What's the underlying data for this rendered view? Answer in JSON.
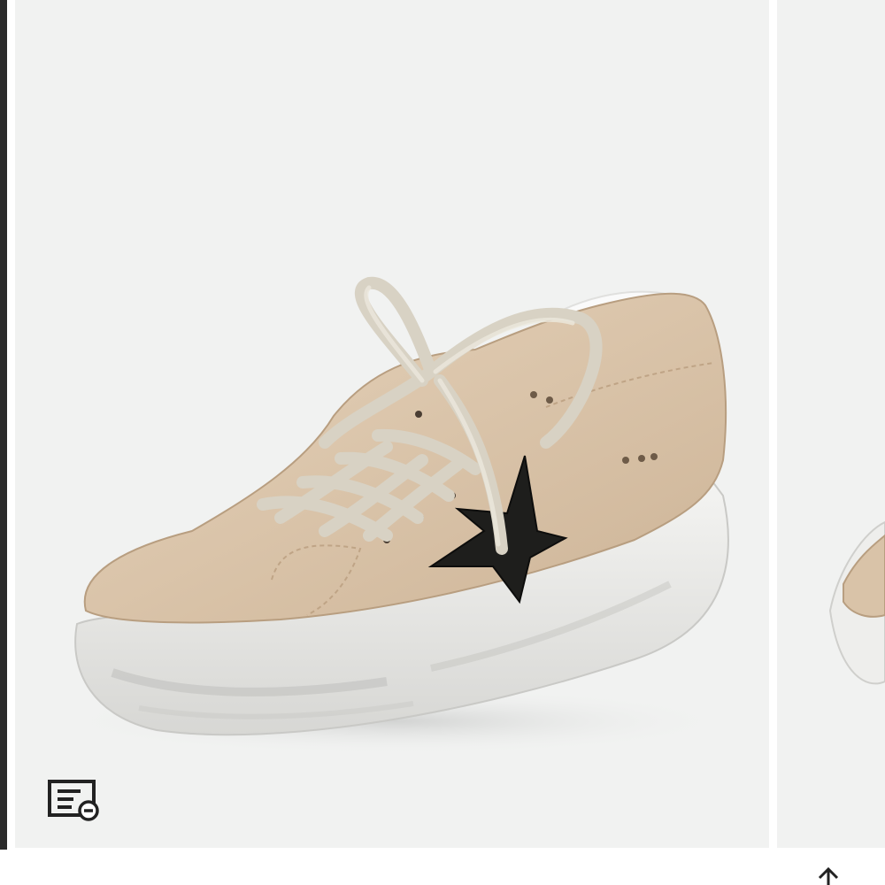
{
  "gallery": {
    "current_image_name": "sneaker-photo-beige-suede-star",
    "next_image_name": "sneaker-photo-partial",
    "background_color": "#f1f2f1"
  },
  "icons": {
    "details": "product-details-icon",
    "back_to_top": "arrow-up-icon"
  },
  "colors": {
    "suede": "#d9c3a8",
    "star": "#1e1e1c",
    "laces": "#e4dfd3",
    "sole": "#e8e8e6"
  }
}
